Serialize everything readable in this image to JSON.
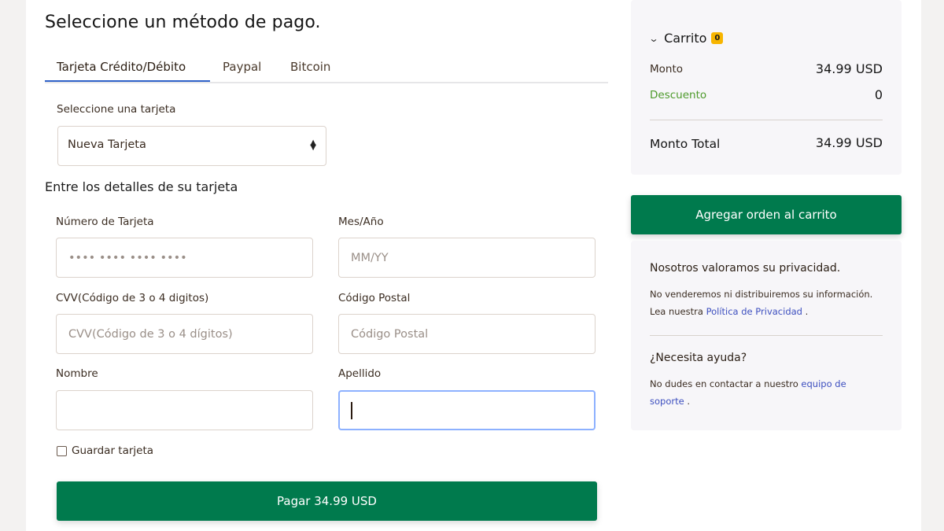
{
  "header": {
    "title": "Seleccione un método de pago."
  },
  "tabs": [
    {
      "label": "Tarjeta Crédito/Débito",
      "active": true
    },
    {
      "label": "Paypal",
      "active": false
    },
    {
      "label": "Bitcoin",
      "active": false
    }
  ],
  "card_select": {
    "label": "Seleccione una tarjeta",
    "value": "Nueva Tarjeta",
    "icon": "sort-arrows-icon"
  },
  "details": {
    "title": "Entre los detalles de su tarjeta",
    "card_number": {
      "label": "Número de Tarjeta",
      "placeholder": "•••• •••• •••• ••••",
      "value": ""
    },
    "expiry": {
      "label": "Mes/Año",
      "placeholder": "MM/YY",
      "value": ""
    },
    "cvv": {
      "label": "CVV(Código de 3 o 4 digitos)",
      "placeholder": "CVV(Código de 3 o 4 dígitos)",
      "value": ""
    },
    "postal": {
      "label": "Código Postal",
      "placeholder": "Código Postal",
      "value": ""
    },
    "first_name": {
      "label": "Nombre",
      "placeholder": "",
      "value": ""
    },
    "last_name": {
      "label": "Apellido",
      "placeholder": "",
      "value": "",
      "focused": true
    },
    "save_card": {
      "label": "Guardar tarjeta",
      "checked": false
    },
    "pay_button": "Pagar 34.99 USD"
  },
  "cart": {
    "title": "Carrito",
    "badge": "0",
    "amount_label": "Monto",
    "amount_value": "34.99 USD",
    "discount_label": "Descuento",
    "discount_value": "0",
    "total_label": "Monto Total",
    "total_value": "34.99 USD"
  },
  "add_order_button": "Agregar orden al carrito",
  "privacy": {
    "title": "Nosotros valoramos su privacidad.",
    "text": "No venderemos ni distribuiremos su información.",
    "read_prefix": "Lea nuestra",
    "policy_link": "Política de Privacidad",
    "suffix": "."
  },
  "help": {
    "title": "¿Necesita ayuda?",
    "text": "No dudes en contactar a nuestro",
    "support_link_1": "equipo de",
    "support_link_2": "soporte",
    "suffix": "."
  },
  "colors": {
    "primary_green": "#007a4d",
    "tab_accent": "#2f62c9",
    "badge": "#f7b500",
    "discount": "#4d9a2b",
    "link": "#3d4fbf"
  }
}
